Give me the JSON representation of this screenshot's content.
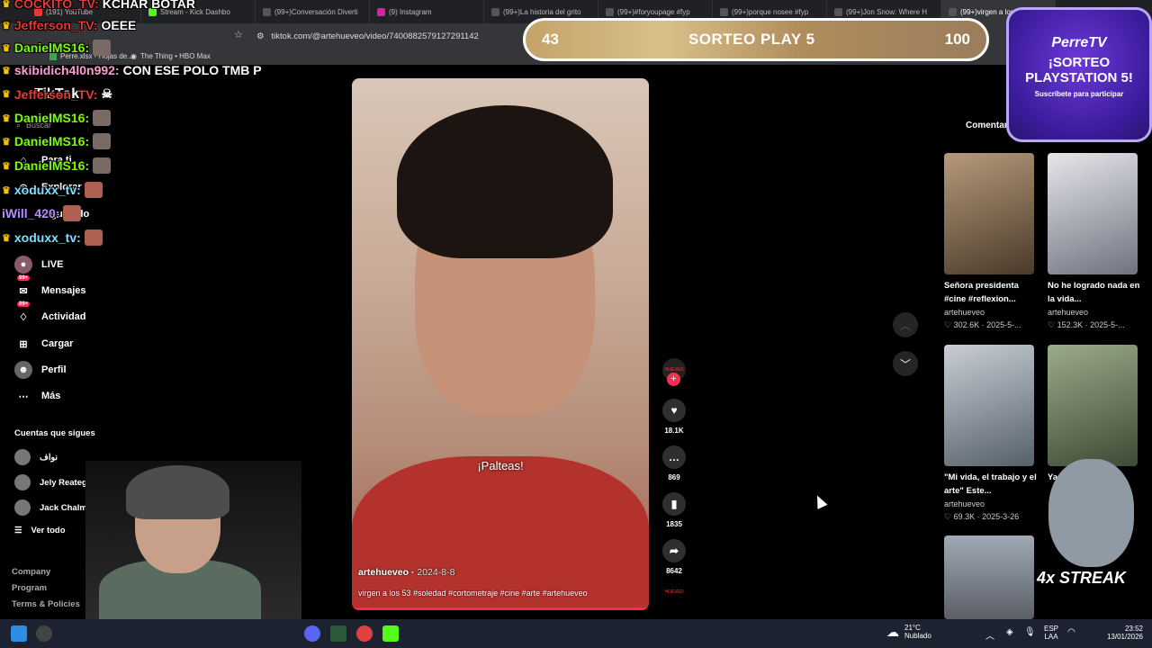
{
  "browser": {
    "tabs": [
      {
        "label": "(191) YouTube"
      },
      {
        "label": "Stream - Kick Dashbo"
      },
      {
        "label": "(99+)Conversación Diverti"
      },
      {
        "label": "(9) Instagram"
      },
      {
        "label": "(99+)La historia del grito"
      },
      {
        "label": "(99+)#foryoupage #fyp"
      },
      {
        "label": "(99+)porque nosee #fyp"
      },
      {
        "label": "(99+)Jon Snow: Where H"
      },
      {
        "label": "(99+)virgen a los 5"
      }
    ],
    "url": "tiktok.com/@artehueveo/video/7400882579127291142",
    "bookmarks": [
      "Perre.xlsx - Hojas de...",
      "The Thing • HBO Max"
    ]
  },
  "tiktok": {
    "logo": "TikTok",
    "search_placeholder": "Buscar",
    "nav": [
      {
        "label": "Para ti",
        "icon": "home-icon"
      },
      {
        "label": "Explorar",
        "icon": "compass-icon"
      },
      {
        "label": "Siguiendo",
        "icon": "following-icon"
      },
      {
        "label": "LIVE",
        "icon": "live-icon"
      },
      {
        "label": "Mensajes",
        "icon": "message-icon",
        "badge": "99+"
      },
      {
        "label": "Actividad",
        "icon": "activity-icon",
        "badge": "99+"
      },
      {
        "label": "Cargar",
        "icon": "upload-icon"
      },
      {
        "label": "Perfil",
        "icon": "profile-icon"
      },
      {
        "label": "Más",
        "icon": "more-icon"
      }
    ],
    "following_title": "Cuentas que sigues",
    "following": [
      "نواف",
      "Jely Reategui",
      "Jack Chalmers"
    ],
    "see_all": "Ver todo",
    "footer": [
      "Company",
      "Program",
      "Terms & Policies"
    ],
    "video": {
      "subtitle": "¡Palteas!",
      "author": "artehueveo",
      "date": "2024-8-8",
      "description": "virgen a los 53 #soledad #cortometraje #cine #arte #artehueveo",
      "likes": "18.1K",
      "comments": "869",
      "saves": "1835",
      "shares": "8642"
    },
    "right_tab": "Comentarios",
    "recommended": [
      {
        "title": "Señora presidenta #cine #reflexion...",
        "author": "artehueveo",
        "views": "302.6K",
        "date": "2025-5-..."
      },
      {
        "title": "No he logrado nada en la vida...",
        "author": "artehueveo",
        "views": "152.3K",
        "date": "2025-5-..."
      },
      {
        "title": "\"Mi vida, el trabajo y el arte\" Este...",
        "author": "artehueveo",
        "views": "69.3K",
        "date": "2025-3-26"
      },
      {
        "title": "Ya t...",
        "author": "",
        "views": "",
        "date": ""
      }
    ]
  },
  "overlay": {
    "sorteo_left": "43",
    "sorteo_title": "SORTEO PLAY 5",
    "sorteo_right": "100",
    "promo_brand": "PerreTV",
    "promo_title": "¡SORTEO PLAYSTATION 5!",
    "promo_sub": "Suscríbete para participar",
    "streak": "4x STREAK",
    "chat": [
      {
        "user": "COCKITO_TV:",
        "text": "KCHAR BOTAR",
        "color": "#e53935"
      },
      {
        "user": "Jefferson_TV:",
        "text": "OEEE",
        "color": "#e53935"
      },
      {
        "user": "DanielMS16:",
        "text": "",
        "color": "#7CFC00"
      },
      {
        "user": "skibidich4l0n992:",
        "text": "CON ESE POLO TMB P",
        "color": "#ff9ad5"
      },
      {
        "user": "Jefferson_TV:",
        "text": "",
        "color": "#e53935"
      },
      {
        "user": "DanielMS16:",
        "text": "",
        "color": "#7CFC00"
      },
      {
        "user": "DanielMS16:",
        "text": "",
        "color": "#7CFC00"
      },
      {
        "user": "DanielMS16:",
        "text": "",
        "color": "#7CFC00"
      },
      {
        "user": "xoduxx_tv:",
        "text": "",
        "color": "#7ee0ff"
      },
      {
        "user": "iWill_420:",
        "text": "",
        "color": "#b58cff"
      },
      {
        "user": "xoduxx_tv:",
        "text": "",
        "color": "#7ee0ff"
      }
    ]
  },
  "taskbar": {
    "weather_temp": "21°C",
    "weather_desc": "Nublado",
    "lang": "ESP",
    "lang2": "LAA",
    "time": "23:52",
    "date": "13/01/2026"
  }
}
